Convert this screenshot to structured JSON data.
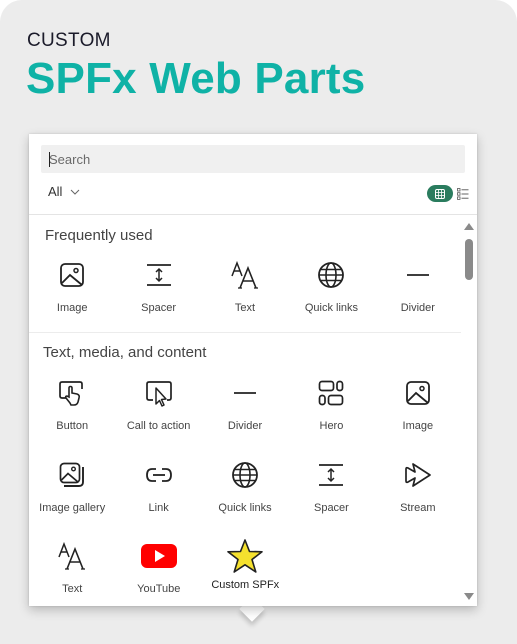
{
  "header": {
    "eyebrow": "CUSTOM",
    "title": "SPFx Web Parts"
  },
  "colors": {
    "accent": "#0fb2a6",
    "toggle_active": "#2a7c5e",
    "youtube_red": "#ff0000",
    "star_yellow": "#f5e12e"
  },
  "toolbox": {
    "search": {
      "placeholder": "Search",
      "value": ""
    },
    "filter": {
      "selected": "All",
      "icon": "chevron-down-icon"
    },
    "view_toggle": {
      "active": "grid-view",
      "options": [
        "grid-view",
        "list-view"
      ]
    },
    "sections": [
      {
        "title": "Frequently used",
        "items": [
          {
            "label": "Image",
            "icon": "image-icon"
          },
          {
            "label": "Spacer",
            "icon": "spacer-icon"
          },
          {
            "label": "Text",
            "icon": "text-icon"
          },
          {
            "label": "Quick links",
            "icon": "globe-icon"
          },
          {
            "label": "Divider",
            "icon": "divider-icon"
          }
        ]
      },
      {
        "title": "Text, media, and content",
        "items": [
          {
            "label": "Button",
            "icon": "button-icon"
          },
          {
            "label": "Call to action",
            "icon": "call-to-action-icon"
          },
          {
            "label": "Divider",
            "icon": "divider-icon"
          },
          {
            "label": "Hero",
            "icon": "hero-icon"
          },
          {
            "label": "Image",
            "icon": "image-icon"
          },
          {
            "label": "Image gallery",
            "icon": "image-gallery-icon"
          },
          {
            "label": "Link",
            "icon": "link-icon"
          },
          {
            "label": "Quick links",
            "icon": "globe-icon"
          },
          {
            "label": "Spacer",
            "icon": "spacer-icon"
          },
          {
            "label": "Stream",
            "icon": "stream-icon"
          },
          {
            "label": "Text",
            "icon": "text-icon"
          },
          {
            "label": "YouTube",
            "icon": "youtube-icon"
          },
          {
            "label": "Custom SPFx",
            "icon": "star-icon"
          }
        ]
      }
    ]
  }
}
